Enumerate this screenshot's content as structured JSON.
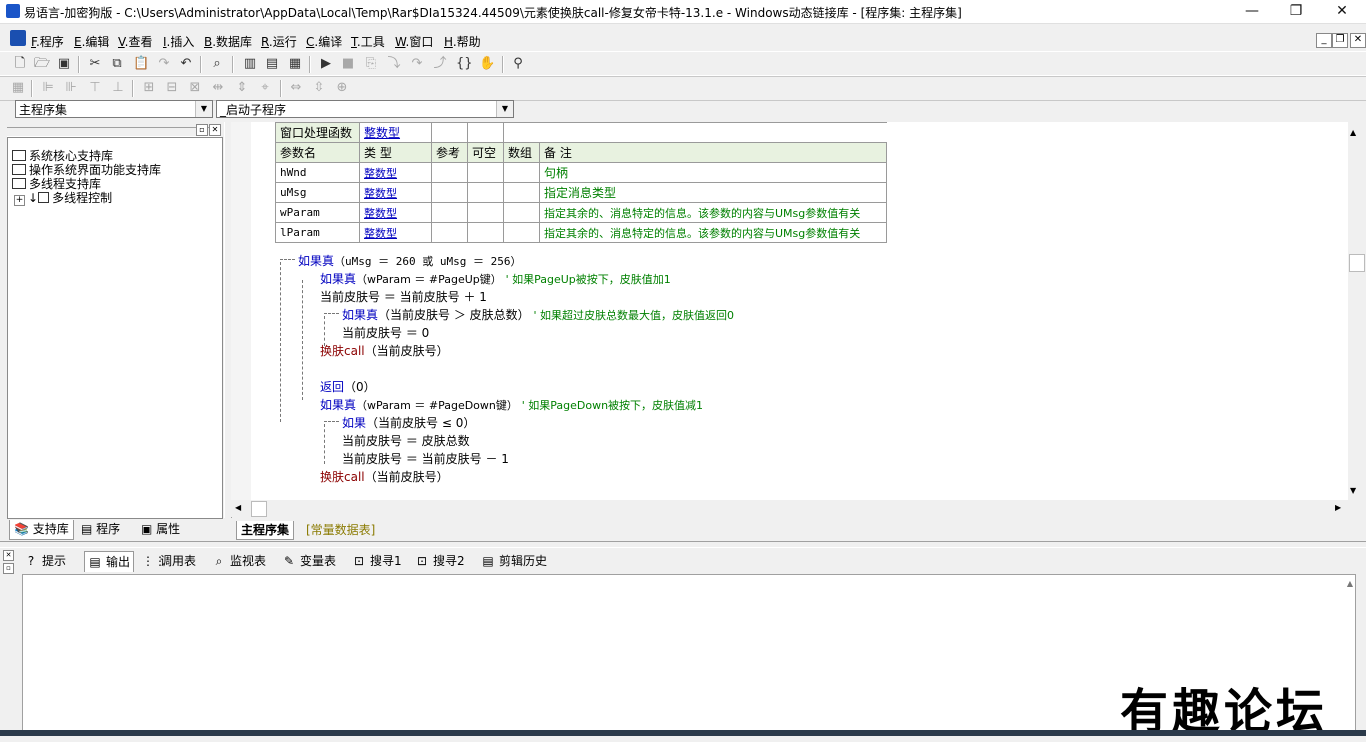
{
  "window": {
    "title": "易语言-加密狗版 - C:\\Users\\Administrator\\AppData\\Local\\Temp\\Rar$DIa15324.44509\\元素使换肤call-修复女帝卡特-13.1.e - Windows动态链接库 - [程序集: 主程序集]",
    "minimize": "—",
    "maximize": "❐",
    "close": "✕"
  },
  "menu": [
    {
      "key": "F",
      "label": ".程序"
    },
    {
      "key": "E",
      "label": ".编辑"
    },
    {
      "key": "V",
      "label": ".查看"
    },
    {
      "key": "I",
      "label": ".插入"
    },
    {
      "key": "B",
      "label": ".数据库"
    },
    {
      "key": "R",
      "label": ".运行"
    },
    {
      "key": "C",
      "label": ".编译"
    },
    {
      "key": "T",
      "label": ".工具"
    },
    {
      "key": "W",
      "label": ".窗口"
    },
    {
      "key": "H",
      "label": ".帮助"
    }
  ],
  "combos": {
    "module": "主程序集",
    "sub": "_启动子程序"
  },
  "left_panel": {
    "libraries": [
      "系统核心支持库",
      "操作系统界面功能支持库",
      "多线程支持库"
    ],
    "subnode": "多线程控制",
    "tabs": [
      "支持库",
      "程序",
      "属性"
    ]
  },
  "param_table": {
    "func_row": {
      "name": "窗口处理函数",
      "type": "整数型"
    },
    "headers": [
      "参数名",
      "类 型",
      "参考",
      "可空",
      "数组",
      "备 注"
    ],
    "rows": [
      {
        "name": "hWnd",
        "type": "整数型",
        "note": "句柄"
      },
      {
        "name": "uMsg",
        "type": "整数型",
        "note": "指定消息类型"
      },
      {
        "name": "wParam",
        "type": "整数型",
        "note": "指定其余的、消息特定的信息。该参数的内容与UMsg参数值有关"
      },
      {
        "name": "lParam",
        "type": "整数型",
        "note": "指定其余的、消息特定的信息。该参数的内容与UMsg参数值有关"
      }
    ]
  },
  "code": {
    "l1_kw": "如果真",
    "l1_rest": "（uMsg ＝ 260 或 uMsg ＝ 256）",
    "l2_kw": "如果真",
    "l2_rest": "（wParam ＝ #PageUp键）",
    "l2_cm": "' 如果PageUp被按下，皮肤值加1",
    "l3": "当前皮肤号 ＝ 当前皮肤号 ＋ 1",
    "l4_kw": "如果真",
    "l4_rest": "（当前皮肤号 ＞ 皮肤总数）",
    "l4_cm": "' 如果超过皮肤总数最大值，皮肤值返回0",
    "l5": "当前皮肤号 ＝ 0",
    "l6_fn": "换肤call",
    "l6_rest": "（当前皮肤号）",
    "l7_kw": "返回",
    "l7_rest": "（0）",
    "l8_kw": "如果真",
    "l8_rest": "（wParam ＝ #PageDown键）",
    "l8_cm": "' 如果PageDown被按下，皮肤值减1",
    "l9_kw": "如果",
    "l9_rest": "（当前皮肤号 ≤ 0）",
    "l10": "当前皮肤号 ＝ 皮肤总数",
    "l11": "当前皮肤号 ＝ 当前皮肤号 － 1",
    "l12_fn": "换肤call",
    "l12_rest": "（当前皮肤号）"
  },
  "editor_tabs": [
    "主程序集",
    "[常量数据表]"
  ],
  "output_tabs": [
    {
      "icon": "?",
      "label": "提示"
    },
    {
      "icon": "▤",
      "label": "输出"
    },
    {
      "icon": "⋮⋮",
      "label": "调用表"
    },
    {
      "icon": "⌕",
      "label": "监视表"
    },
    {
      "icon": "✎",
      "label": "变量表"
    },
    {
      "icon": "⊡",
      "label": "搜寻1"
    },
    {
      "icon": "⊡",
      "label": "搜寻2"
    },
    {
      "icon": "▤",
      "label": "剪辑历史"
    }
  ],
  "watermark": "有趣论坛",
  "colors": {
    "keyword": "#0000c0",
    "comment": "#008000",
    "call": "#8b0000",
    "table_header": "#e8f2e0"
  }
}
